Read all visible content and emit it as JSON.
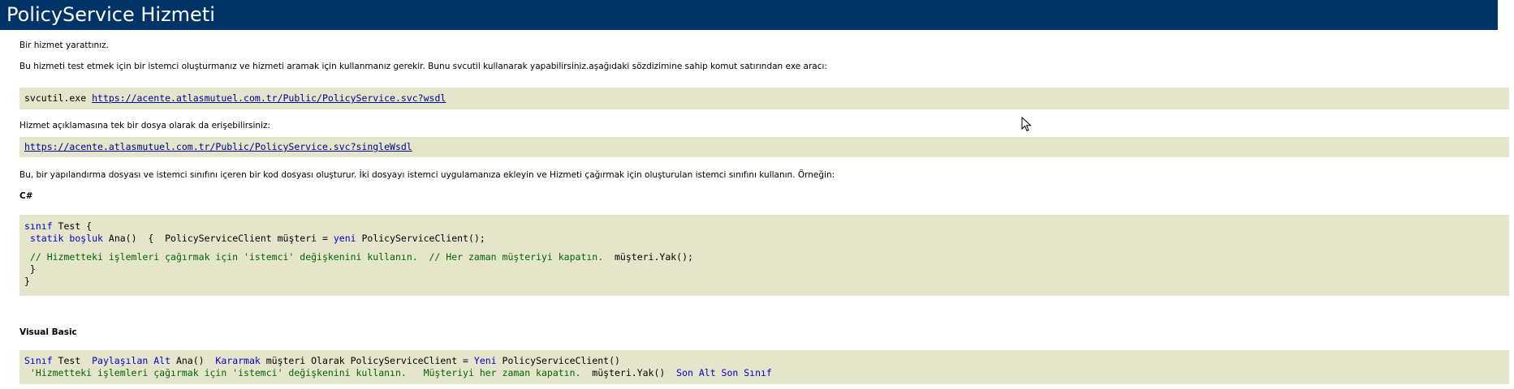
{
  "page": {
    "title": "PolicyService Hizmeti"
  },
  "intro": {
    "created": "Bir hizmet yarattınız.",
    "instructions": "Bu hizmeti test etmek için bir istemci oluşturmanız ve hizmeti aramak için kullanmanız gerekir. Bunu svcutil kullanarak yapabilirsiniz.aşağıdaki sözdizimine sahip komut satırından exe aracı:"
  },
  "svcutil": {
    "command": "svcutil.exe",
    "wsdl_url": "https://acente.atlasmutuel.com.tr/Public/PolicyService.svc?wsdl"
  },
  "single_file": {
    "label": "Hizmet açıklamasına tek bir dosya olarak da erişebilirsiniz:",
    "url": "https://acente.atlasmutuel.com.tr/Public/PolicyService.svc?singleWsdl"
  },
  "explanation": "Bu, bir yapılandırma dosyası ve istemci sınıfını içeren bir kod dosyası oluşturur. İki dosyayı istemci uygulamanıza ekleyin ve Hizmeti çağırmak için oluşturulan istemci sınıfını kullanın. Örneğin:",
  "csharp": {
    "heading": "C#",
    "l1_kw": "sınıf",
    "l1_rest": " Test {",
    "l2_kw1": "statik",
    "l2_kw2": "boşluk",
    "l2_mid": " Ana()  {  PolicyServiceClient müşteri = ",
    "l2_kw3": "yeni",
    "l2_end": " PolicyServiceClient();",
    "l3_comment": "// Hizmetteki işlemleri çağırmak için 'istemci' değişkenini kullanın.  // Her zaman müşteriyi kapatın.",
    "l3_code": "  müşteri.Yak();",
    "l4": " }",
    "l5": "}"
  },
  "vb": {
    "heading": "Visual Basic",
    "l1_kw1": "Sınıf",
    "l1_a": " Test  ",
    "l1_kw2": "Paylaşılan Alt",
    "l1_b": " Ana()  ",
    "l1_kw3": "Kararmak",
    "l1_c": " müşteri Olarak PolicyServiceClient = ",
    "l1_kw4": "Yeni",
    "l1_d": " PolicyServiceClient()",
    "l2_comment": "'Hizmetteki işlemleri çağırmak için 'istemci' değişkenini kullanın.   Müşteriyi her zaman kapatın.",
    "l2_code": "  müşteri.Yak()  ",
    "l2_kw": "Son Alt Son Sınıf"
  },
  "colors": {
    "header_bg": "#003366",
    "code_bg": "#e5e5cc",
    "keyword": "#0000cc",
    "comment": "#006600",
    "link": "#000099"
  }
}
